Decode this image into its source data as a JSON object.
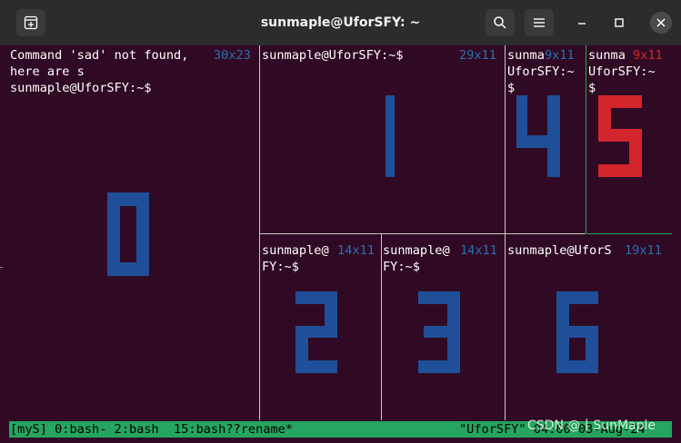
{
  "window": {
    "title": "sunmaple@UforSFY: ~"
  },
  "titlebar": {
    "new_tab_icon": "new-tab-icon",
    "search_icon": "search-icon",
    "menu_icon": "hamburger-menu-icon",
    "minimize_icon": "minimize-icon",
    "maximize_icon": "maximize-icon",
    "close_icon": "close-icon"
  },
  "colors": {
    "terminal_bg": "#300a24",
    "pane_number": "#1f4f98",
    "active_pane_number": "#d2262c",
    "pane_size_text": "#2a6fb0",
    "status_bar": "#25a55f",
    "titlebar": "#2c2c2c"
  },
  "panes": [
    {
      "number": "0",
      "lines": [
        "Command 'sad' not found,",
        "here are s",
        "sunmaple@UforSFY:~$"
      ],
      "size": "30x23"
    },
    {
      "number": "1",
      "lines": [
        "sunmaple@UforSFY:~$"
      ],
      "size": "29x11"
    },
    {
      "number": "4",
      "lines": [
        "sunma",
        "UforSFY:~",
        "$"
      ],
      "size": "9x11"
    },
    {
      "number": "5",
      "lines": [
        "sunma",
        "UforSFY:~",
        "$"
      ],
      "size": "9x11",
      "active": true
    },
    {
      "number": "2",
      "lines": [
        "sunmaple@",
        "FY:~$"
      ],
      "size": "14x11"
    },
    {
      "number": "3",
      "lines": [
        "sunmaple@",
        "FY:~$"
      ],
      "size": "14x11"
    },
    {
      "number": "6",
      "lines": [
        "sunmaple@UforS"
      ],
      "size": "19x11"
    }
  ],
  "status_bar": {
    "left": "[myS] 0:bash- 2:bash  15:bash??rename*",
    "right": "\"UforSFY\" 04:00 03-Aug-24"
  },
  "watermark": "CSDN @丨SunMaple"
}
